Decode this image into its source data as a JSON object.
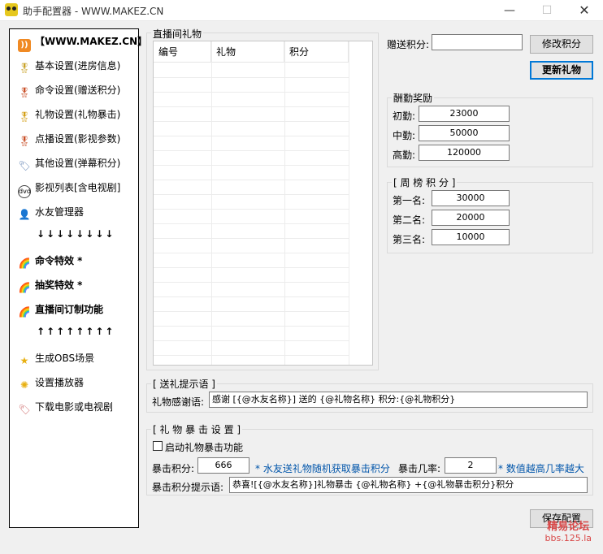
{
  "window": {
    "title": "助手配置器 - WWW.MAKEZ.CN"
  },
  "sidebar": {
    "items": [
      {
        "icon": "rss-icon",
        "label": "【WWW.MAKEZ.CN】",
        "bold": true
      },
      {
        "icon": "medal-icon",
        "label": "基本设置(进房信息)"
      },
      {
        "icon": "medal-icon",
        "label": "命令设置(赠送积分)"
      },
      {
        "icon": "medal-icon",
        "label": "礼物设置(礼物暴击)"
      },
      {
        "icon": "medal-icon",
        "label": "点播设置(影视参数)"
      },
      {
        "icon": "tag-icon",
        "label": "其他设置(弹幕积分)"
      },
      {
        "icon": "dvd-icon",
        "label": "影视列表[含电视剧]"
      },
      {
        "icon": "user-icon",
        "label": "水友管理器"
      },
      {
        "icon": "arrows-down",
        "label": "↓↓↓↓↓↓↓↓"
      },
      {
        "icon": "rainbow-icon",
        "label": "命令特效 *",
        "bold": true
      },
      {
        "icon": "rainbow-icon",
        "label": "抽奖特效 *",
        "bold": true
      },
      {
        "icon": "rainbow-icon",
        "label": "直播间订制功能",
        "bold": true
      },
      {
        "icon": "arrows-up",
        "label": "↑↑↑↑↑↑↑↑"
      },
      {
        "icon": "star-icon",
        "label": "生成OBS场景"
      },
      {
        "icon": "sparkle-icon",
        "label": "设置播放器"
      },
      {
        "icon": "tag-icon",
        "label": "下载电影或电视剧"
      }
    ]
  },
  "gifts": {
    "group_title": "直播间礼物",
    "columns": [
      "编号",
      "礼物",
      "积分"
    ]
  },
  "gift_points": {
    "label": "赠送积分:",
    "value": "",
    "modify_button": "修改积分",
    "update_button": "更新礼物"
  },
  "rewards": {
    "title": "酬勤奖励",
    "rows": [
      {
        "label": "初勤:",
        "value": "23000"
      },
      {
        "label": "中勤:",
        "value": "50000"
      },
      {
        "label": "高勤:",
        "value": "120000"
      }
    ]
  },
  "weekly": {
    "title": "[ 周 榜 积 分 ]",
    "rows": [
      {
        "label": "第一名:",
        "value": "30000"
      },
      {
        "label": "第二名:",
        "value": "20000"
      },
      {
        "label": "第三名:",
        "value": "10000"
      }
    ]
  },
  "thanks": {
    "title": "[ 送礼提示语 ]",
    "label": "礼物感谢语:",
    "value": "感谢 [{@水友名称}] 送的 {@礼物名称} 积分:{@礼物积分}"
  },
  "crit": {
    "title": "[ 礼 物 暴 击 设 置 ]",
    "enable_label": "启动礼物暴击功能",
    "points_label": "暴击积分:",
    "points_value": "666",
    "points_hint": "* 水友送礼物随机获取暴击积分",
    "rate_label": "暴击几率:",
    "rate_value": "2",
    "rate_hint": "* 数值越高几率越大",
    "prompt_label": "暴击积分提示语:",
    "prompt_value": "恭喜![{@水友名称}]礼物暴击 {@礼物名称} +{@礼物暴击积分}积分"
  },
  "save_button": "保存配置",
  "watermark": {
    "line1": "精易论坛",
    "line2": "bbs.125.la"
  }
}
